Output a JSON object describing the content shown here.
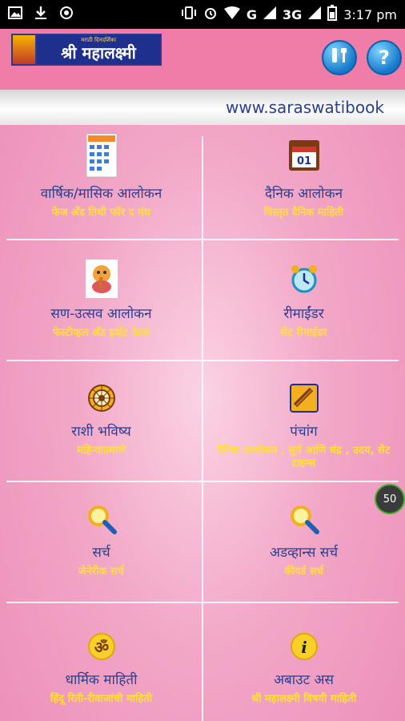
{
  "status_bar": {
    "time": "3:17 pm",
    "network": "G",
    "network2": "3G"
  },
  "header": {
    "logo_title": "श्री महालक्ष्मी",
    "logo_tagline": "मराठी दिनदर्शिका",
    "settings_icon": "tools-icon",
    "help_label": "?"
  },
  "url_bar": {
    "text": "www.saraswatibook"
  },
  "menu": [
    {
      "title": "वार्षिक/मासिक आलोकन",
      "subtitle": "फेज अँड तिथी फॉर द मंथ",
      "icon": "calendar-grid-icon"
    },
    {
      "title": "दैनिक आलोकन",
      "subtitle": "विस्तृत दैनिक माहिती",
      "icon": "daily-calendar-icon"
    },
    {
      "title": "सण-उत्सव आलोकन",
      "subtitle": "फेस्टीव्हल अँड इव्हेंट डेटस",
      "icon": "ganesha-icon"
    },
    {
      "title": "रीमाईंडर",
      "subtitle": "सेट रीमाईंडर",
      "icon": "alarm-clock-icon"
    },
    {
      "title": "राशी भविष्य",
      "subtitle": "महिन्याप्रमाणे",
      "icon": "zodiac-wheel-icon"
    },
    {
      "title": "पंचांग",
      "subtitle": "दैनिक आलोकन , सूर्य आणि चंद्र , उदय, सेट टाइम्स",
      "icon": "panchang-scroll-icon"
    },
    {
      "title": "सर्च",
      "subtitle": "जेनेरीक सर्च",
      "icon": "search-icon"
    },
    {
      "title": "अडव्हान्स सर्च",
      "subtitle": "कीवर्ड सर्च",
      "icon": "advanced-search-icon"
    },
    {
      "title": "धार्मिक माहिती",
      "subtitle": "हिंदू रिती-रीवाजांची माहिती",
      "icon": "om-icon"
    },
    {
      "title": "अबाउट अस",
      "subtitle": "श्री महालक्ष्मी विषयी माहिती",
      "icon": "info-icon"
    }
  ],
  "floating_badge": "50",
  "colors": {
    "header_bg": "#f07ca8",
    "title_text": "#2a3f8f",
    "subtitle_text": "#ffe033",
    "url_text": "#2a3f8f"
  }
}
